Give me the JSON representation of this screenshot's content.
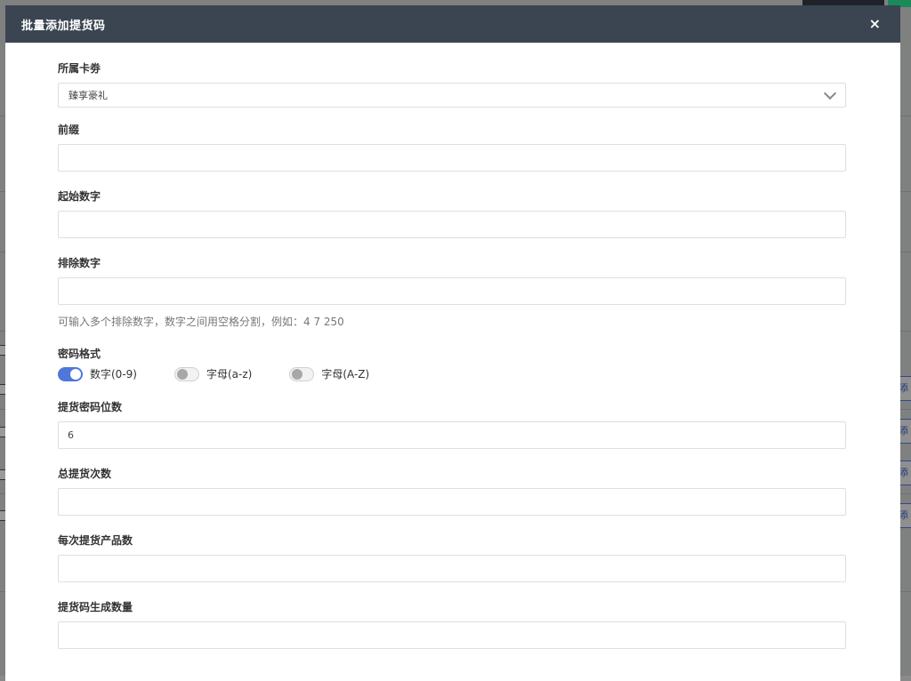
{
  "modal": {
    "title": "批量添加提货码",
    "close_label": "×"
  },
  "form": {
    "card": {
      "label": "所属卡劵",
      "value": "臻享豪礼"
    },
    "prefix": {
      "label": "前缀",
      "value": "",
      "placeholder": ""
    },
    "start_number": {
      "label": "起始数字",
      "value": "",
      "placeholder": ""
    },
    "exclude_numbers": {
      "label": "排除数字",
      "value": "",
      "placeholder": "",
      "hint": "可输入多个排除数字，数字之间用空格分割，例如：4 7 250"
    },
    "password_format": {
      "label": "密码格式",
      "options": [
        {
          "label": "数字(0-9)",
          "checked": true
        },
        {
          "label": "字母(a-z)",
          "checked": false
        },
        {
          "label": "字母(A-Z)",
          "checked": false
        }
      ]
    },
    "password_length": {
      "label": "提货密码位数",
      "value": "6"
    },
    "total_pickups": {
      "label": "总提货次数",
      "value": ""
    },
    "products_per_pickup": {
      "label": "每次提货产品数",
      "value": ""
    },
    "code_count": {
      "label": "提货码生成数量",
      "value": ""
    }
  },
  "background": {
    "right_button_label": "添加",
    "colors": {
      "header": "#3b4551",
      "toggle_on": "#4f77d9"
    }
  }
}
